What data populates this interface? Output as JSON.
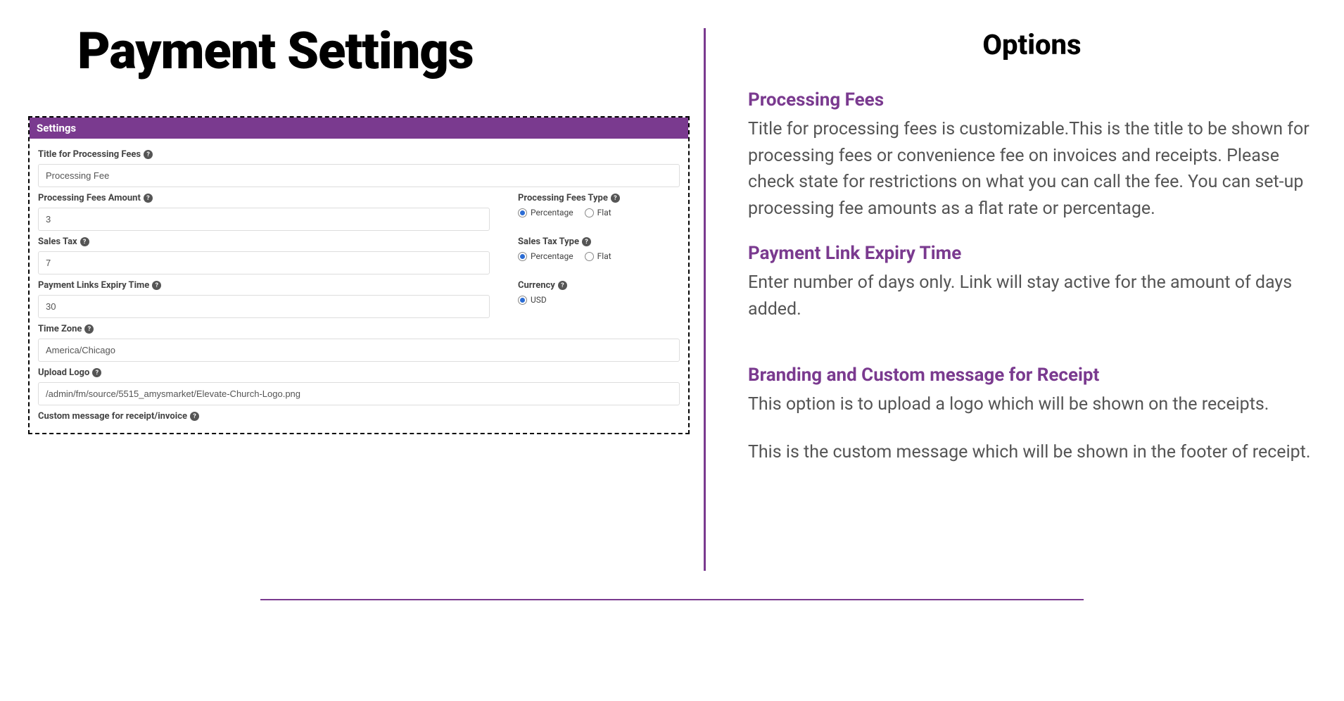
{
  "left": {
    "title": "Payment Settings",
    "panel": {
      "header": "Settings",
      "fields": {
        "title_fees_label": "Title for Processing Fees",
        "title_fees_value": "Processing Fee",
        "fees_amount_label": "Processing Fees Amount",
        "fees_amount_value": "3",
        "fees_type_label": "Processing Fees Type",
        "fees_type_opt1": "Percentage",
        "fees_type_opt2": "Flat",
        "sales_tax_label": "Sales Tax",
        "sales_tax_value": "7",
        "sales_tax_type_label": "Sales Tax Type",
        "sales_tax_type_opt1": "Percentage",
        "sales_tax_type_opt2": "Flat",
        "expiry_label": "Payment Links Expiry Time",
        "expiry_value": "30",
        "currency_label": "Currency",
        "currency_opt1": "USD",
        "timezone_label": "Time Zone",
        "timezone_value": "America/Chicago",
        "logo_label": "Upload Logo",
        "logo_value": "/admin/fm/source/5515_amysmarket/Elevate-Church-Logo.png",
        "custom_msg_label": "Custom message for receipt/invoice"
      }
    }
  },
  "right": {
    "title": "Options",
    "sections": {
      "s1_title": "Processing Fees",
      "s1_body": "Title for processing fees is customizable.This is the title to be shown for processing fees or convenience fee on invoices and receipts. Please check state for restrictions on what you can call the fee. You can set-up processing fee amounts as a flat rate or percentage.",
      "s2_title": "Payment Link Expiry Time",
      "s2_body": "Enter number of days only. Link will stay active for the amount of days added.",
      "s3_title": "Branding and Custom message for Receipt",
      "s3_body1": "This option is to upload a logo which will be shown on the receipts.",
      "s3_body2": "This is the custom message which will be shown in the footer of receipt."
    }
  }
}
